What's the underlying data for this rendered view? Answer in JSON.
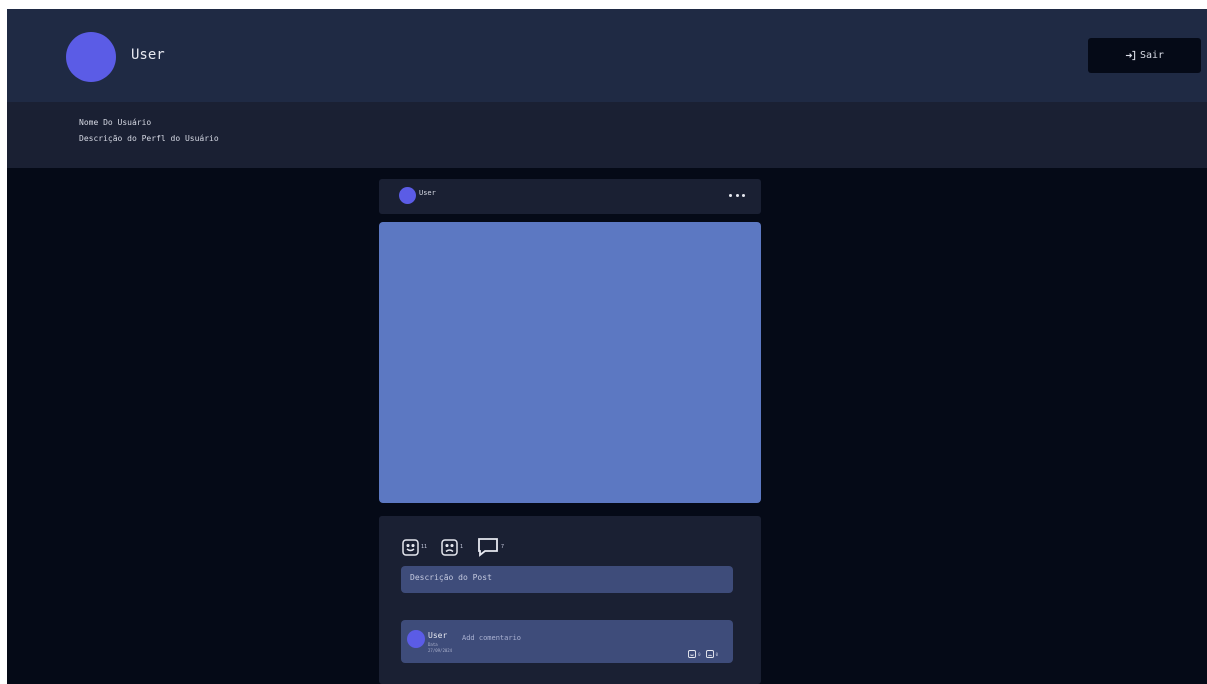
{
  "header": {
    "username": "User",
    "logout_label": "Sair"
  },
  "profile": {
    "name": "Nome Do Usuário",
    "description": "Descrição do Perfl do Usuário"
  },
  "post": {
    "username": "User",
    "reactions": {
      "happy_count": "11",
      "sad_count": "1",
      "comment_count": "7"
    },
    "description_placeholder": "Descrição do Post",
    "comment": {
      "username": "User",
      "meta_line1": "Data",
      "meta_line2": "27/09/2024",
      "placeholder": "Add comentario",
      "happy_count": "0",
      "sad_count": "0"
    }
  },
  "colors": {
    "background": "#050a17",
    "header": "#1f2a44",
    "panel": "#1a2033",
    "accent_avatar": "#5b5ce6",
    "image_placeholder": "#5c78c2",
    "field": "#3e4c7a"
  }
}
